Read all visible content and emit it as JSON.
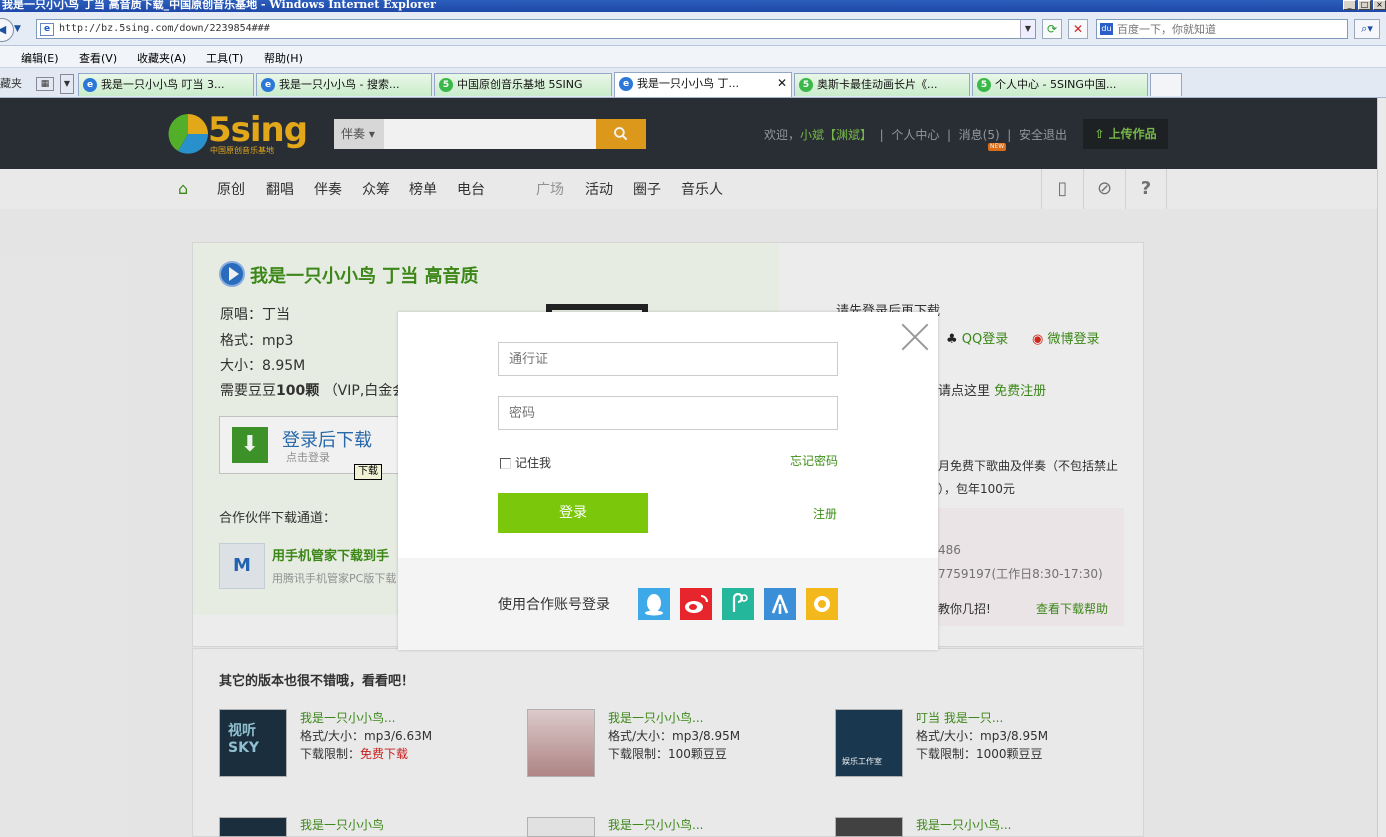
{
  "window": {
    "title": "我是一只小小鸟 丁当 高音质下载_中国原创音乐基地 - Windows Internet Explorer"
  },
  "browser": {
    "url": "http://bz.5sing.com/down/2239854###",
    "search_placeholder": "百度一下，你就知道",
    "menu": [
      "编辑(E)",
      "查看(V)",
      "收藏夹(A)",
      "工具(T)",
      "帮助(H)"
    ],
    "fav_label": "藏夹",
    "tabs": [
      {
        "label": "我是一只小小鸟 叮当 3...",
        "icon": "ie"
      },
      {
        "label": "我是一只小小鸟 - 搜索...",
        "icon": "ie"
      },
      {
        "label": "中国原创音乐基地 5SING",
        "icon": "5sing"
      },
      {
        "label": "我是一只小小鸟 丁...",
        "icon": "ie",
        "active": true
      },
      {
        "label": "奥斯卡最佳动画长片《...",
        "icon": "5sing"
      },
      {
        "label": "个人中心 - 5SING中国...",
        "icon": "5sing"
      }
    ]
  },
  "site": {
    "logo_text": "5sing",
    "logo_sub": "中国原创音乐基地",
    "search_category": "伴奏",
    "user": {
      "welcome": "欢迎，",
      "name": "小斌【渊斌】",
      "center": "个人中心",
      "messages": "消息(5)",
      "new_badge": "NEW",
      "logout": "安全退出",
      "upload": "上传作品"
    },
    "nav": [
      "原创",
      "翻唱",
      "伴奏",
      "众筹",
      "榜单",
      "电台",
      "广场",
      "活动",
      "圈子",
      "音乐人"
    ]
  },
  "song": {
    "title": "我是一只小小鸟 丁当 高音质",
    "original_singer": "原唱：丁当",
    "format": "格式：mp3",
    "size": "大小：8.95M",
    "cost_prefix": "需要豆豆",
    "cost_amount": "100颗",
    "cost_note": "（VIP,白金会",
    "download_button": "登录后下载",
    "download_sub": "点击登录",
    "tooltip": "下载",
    "partner_label": "合作伙伴下载通道：",
    "partner_title": "用手机管家下载到手",
    "partner_desc": "用腾讯手机管家PC版下载"
  },
  "right_panel": {
    "login_prompt": "请先登录后再下载",
    "qq_login": "QQ登录",
    "weibo_login": "微博登录",
    "register_prompt": "请点这里",
    "register_link": "免费注册",
    "vip_line1": "月免费下歌曲及伴奏（不包括禁止",
    "vip_line2": "），包年100元",
    "phone1": "486",
    "phone2": "7759197(工作日8:30-17:30)",
    "tips": "教你几招!",
    "help_link": "查看下载帮助"
  },
  "others": {
    "heading": "其它的版本也很不错哦，看看吧！",
    "items": [
      {
        "title": "我是一只小小鸟...",
        "format": "格式/大小：mp3/6.63M",
        "limit_label": "下载限制：",
        "limit_value": "免费下载",
        "thumb": "视听SKY"
      },
      {
        "title": "我是一只小小鸟...",
        "format": "格式/大小：mp3/8.95M",
        "limit_label": "下载限制：",
        "limit_value": "100颗豆豆",
        "thumb": ""
      },
      {
        "title": "叮当 我是一只...",
        "format": "格式/大小：mp3/8.95M",
        "limit_label": "下载限制：",
        "limit_value": "1000颗豆豆",
        "thumb": "娱乐工作室"
      }
    ],
    "row2": [
      "我是一只小小鸟",
      "我是一只小小鸟...",
      "我是一只小小鸟..."
    ]
  },
  "modal": {
    "username_placeholder": "通行证",
    "password_placeholder": "密码",
    "remember": "记住我",
    "forgot": "忘记密码",
    "login": "登录",
    "register": "注册",
    "partner_login": "使用合作账号登录"
  },
  "colors": {
    "accent_green": "#7ac70c",
    "link_green": "#3f8f19",
    "header_dark": "#2b3037",
    "search_orange": "#e8a11b"
  }
}
